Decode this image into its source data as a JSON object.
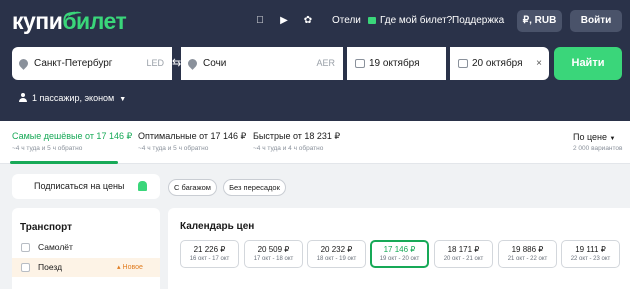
{
  "header": {
    "logo": {
      "part1": "купи",
      "part2": "билет"
    },
    "app_icons": [
      "apple-icon",
      "google-play-icon",
      "huawei-icon"
    ],
    "nav": {
      "hotels": "Отели",
      "my_ticket": "Где мой билет?",
      "support": "Поддержка"
    },
    "currency": "₽, RUB",
    "login": "Войти"
  },
  "search": {
    "from": {
      "city": "Санкт-Петербург",
      "code": "LED"
    },
    "to": {
      "city": "Сочи",
      "code": "AER"
    },
    "departure": "19 октября",
    "return": "20 октября",
    "clear": "×",
    "find": "Найти",
    "passengers": "1 пассажир, эконом"
  },
  "sort": {
    "tabs": [
      {
        "label": "Самые дешёвые от 17 146 ₽",
        "sub": "~4 ч туда и 5 ч обратно",
        "active": true
      },
      {
        "label": "Оптимальные от 17 146 ₽",
        "sub": "~4 ч туда и 5 ч обратно",
        "active": false
      },
      {
        "label": "Быстрые от 18 231 ₽",
        "sub": "~4 ч туда и 4 ч обратно",
        "active": false
      }
    ],
    "order": {
      "label": "По цене",
      "sub": "2 000 вариантов"
    }
  },
  "filters": {
    "subscribe": "Подписаться на цены",
    "chips": [
      "С багажом",
      "Без пересадок"
    ],
    "transport": {
      "title": "Транспорт",
      "options": [
        {
          "label": "Самолёт",
          "badge": ""
        },
        {
          "label": "Поезд",
          "badge": "Новое"
        }
      ]
    }
  },
  "calendar": {
    "title": "Календарь цен",
    "days": [
      {
        "price": "21 226 ₽",
        "dates": "16 окт - 17 окт",
        "selected": false
      },
      {
        "price": "20 509 ₽",
        "dates": "17 окт - 18 окт",
        "selected": false
      },
      {
        "price": "20 232 ₽",
        "dates": "18 окт - 19 окт",
        "selected": false
      },
      {
        "price": "17 146 ₽",
        "dates": "19 окт - 20 окт",
        "selected": true
      },
      {
        "price": "18 171 ₽",
        "dates": "20 окт - 21 окт",
        "selected": false
      },
      {
        "price": "19 886 ₽",
        "dates": "21 окт - 22 окт",
        "selected": false
      },
      {
        "price": "19 111 ₽",
        "dates": "22 окт - 23 окт",
        "selected": false
      }
    ]
  },
  "colors": {
    "header_bg": "#2a3249",
    "accent": "#3ad67a",
    "active_green": "#17a957",
    "badge_orange": "#e07d22"
  }
}
